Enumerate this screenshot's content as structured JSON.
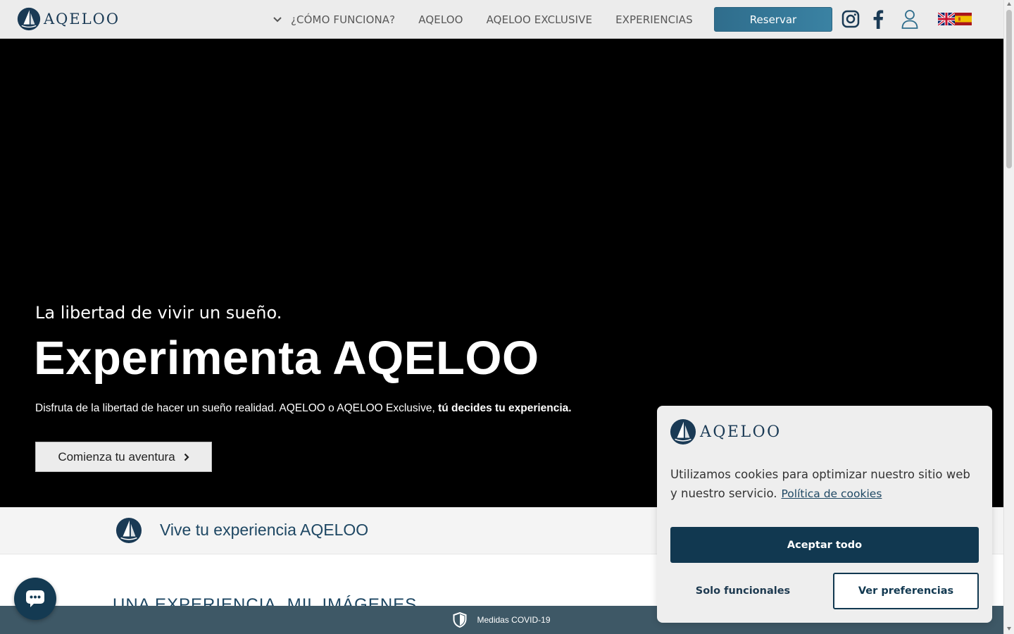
{
  "header": {
    "logo_text": "AQELOO",
    "nav": [
      "¿CÓMO FUNCIONA?",
      "AQELOO",
      "AQELOO EXCLUSIVE",
      "EXPERIENCIAS"
    ],
    "reserve_label": "Reservar",
    "icons": [
      "instagram-icon",
      "facebook-icon",
      "user-icon",
      "flag-en-icon",
      "flag-es-icon"
    ]
  },
  "hero": {
    "subtitle": "La libertad de vivir un sueño.",
    "title": "Experimenta AQELOO",
    "description": "Disfruta de la libertad de hacer un sueño realidad. AQELOO o AQELOO Exclusive, ",
    "description_bold": "tú decides tu experiencia.",
    "cta_label": "Comienza tu aventura"
  },
  "strip": {
    "text": "Vive tu experiencia AQELOO"
  },
  "section": {
    "title": "UNA EXPERIENCIA, MIL IMÁGENES"
  },
  "bottom_bar": {
    "label": "Medidas COVID-19"
  },
  "cookie": {
    "logo_text": "AQELOO",
    "message": "Utilizamos cookies para optimizar nuestro sitio web y nuestro servicio.",
    "policy_link": "Política de cookies",
    "accept_label": "Aceptar todo",
    "functional_label": "Solo funcionales",
    "prefs_label": "Ver preferencias"
  },
  "colors": {
    "brand_dark": "#113850",
    "brand_blue": "#2f6d8c",
    "header_bg": "#ececec",
    "covid_bar": "#3e5866"
  }
}
